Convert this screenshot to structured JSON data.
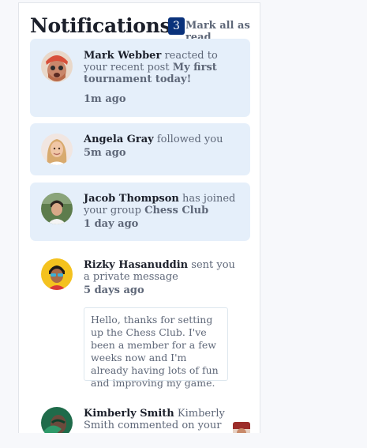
{
  "header": {
    "title": "Notifications",
    "unread_count": "3",
    "mark_all_label": "Mark all as read"
  },
  "notifications": [
    {
      "name": "Mark Webber",
      "action": "reacted to your recent post",
      "target": "My first tournament today!",
      "time": "1m ago",
      "unread": true
    },
    {
      "name": "Angela Gray",
      "action": "followed you",
      "time": "5m ago",
      "unread": true
    },
    {
      "name": "Jacob Thompson",
      "action": "has joined your group",
      "target": "Chess Club",
      "time": "1 day ago",
      "unread": true
    },
    {
      "name": "Rizky Hasanuddin",
      "action": "sent you a private message",
      "time": "5 days ago",
      "message": "Hello, thanks for setting up the Chess Club. I've been a member for a few weeks now and I'm already having lots of fun and improving my game.",
      "unread": false
    },
    {
      "name": "Kimberly Smith",
      "action": "Kimberly Smith commented on your",
      "unread": false
    }
  ],
  "colors": {
    "unread_bg": "#e5effa",
    "badge_bg": "#0a327b",
    "heading": "#1c202b",
    "muted": "#5e6778"
  }
}
